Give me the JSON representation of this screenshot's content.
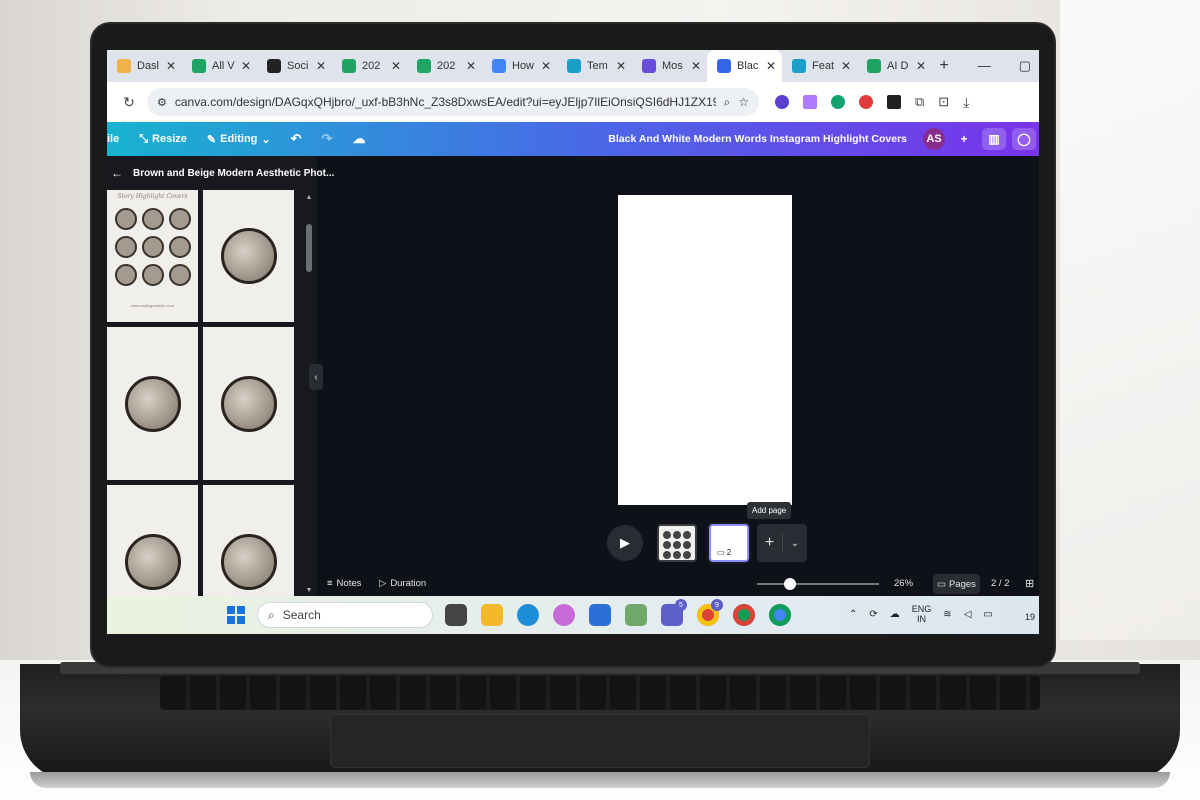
{
  "browser": {
    "tabs": [
      {
        "label": "Dasl",
        "color": "#f2b24a",
        "active": false
      },
      {
        "label": "All V",
        "color": "#1fa463",
        "active": false
      },
      {
        "label": "Soci",
        "color": "#222222",
        "active": false
      },
      {
        "label": "202",
        "color": "#1fa463",
        "active": false
      },
      {
        "label": "202",
        "color": "#1fa463",
        "active": false
      },
      {
        "label": "How",
        "color": "#4285f4",
        "active": false
      },
      {
        "label": "Tem",
        "color": "#1aa0c8",
        "active": false
      },
      {
        "label": "Mos",
        "color": "#6a4cdb",
        "active": false
      },
      {
        "label": "Blac",
        "color": "#3566e8",
        "active": true
      },
      {
        "label": "Feat",
        "color": "#1aa0c8",
        "active": false
      },
      {
        "label": "AI D",
        "color": "#1fa463",
        "active": false
      }
    ],
    "new_tab": "+",
    "url": "canva.com/design/DAGqxQHjbro/_uxf-bB3hNc_Z3s8DxwsEA/edit?ui=eyJEljp7IlEiOnsiQSI6dHJ1ZX19fQ"
  },
  "canva": {
    "header": {
      "file_label": "ile",
      "resize_label": "Resize",
      "editing_label": "Editing",
      "design_title": "Black And White Modern Words Instagram Highlight Covers",
      "avatar_initials": "AS"
    },
    "panel": {
      "title": "Brown and Beige Modern Aesthetic Phot...",
      "thumb_caption": "Story Highlight Covers",
      "thumb_footer": "www.reallygreatsite.com"
    },
    "tooltip": "Add page",
    "page_thumb_number": "2",
    "footer": {
      "notes_label": "Notes",
      "duration_label": "Duration",
      "zoom": "26%",
      "zoom_fraction": 0.26,
      "pages_label": "Pages",
      "page_count": "2 / 2"
    }
  },
  "taskbar": {
    "search_placeholder": "Search",
    "badges": {
      "teams": "5",
      "chrome": "9"
    },
    "lang_line1": "ENG",
    "lang_line2": "IN",
    "clock_partial": "19"
  },
  "colors": {
    "header_start": "#18b3d0",
    "header_end": "#7a33ea",
    "editor_bg": "#0e1117",
    "avatar": "#8a2b8f"
  }
}
